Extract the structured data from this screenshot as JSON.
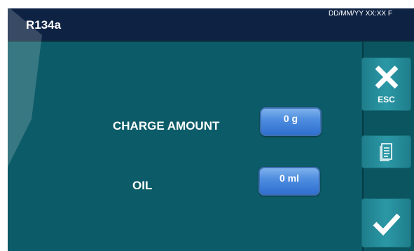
{
  "header": {
    "title": "R134a",
    "datetime": "DD/MM/YY XX:XX F"
  },
  "form": {
    "charge_label": "CHARGE AMOUNT",
    "charge_value": "0 g",
    "oil_label": "OIL",
    "oil_value": "0 ml"
  },
  "side": {
    "esc_label": "ESC",
    "esc_icon": "close-icon",
    "doc_icon": "document-icon",
    "confirm_icon": "check-icon"
  },
  "colors": {
    "screen_bg": "#0c5b68",
    "header_bg": "#0e2344",
    "button_blue": "#4f8ee0",
    "side_button": "#2b98a6"
  }
}
